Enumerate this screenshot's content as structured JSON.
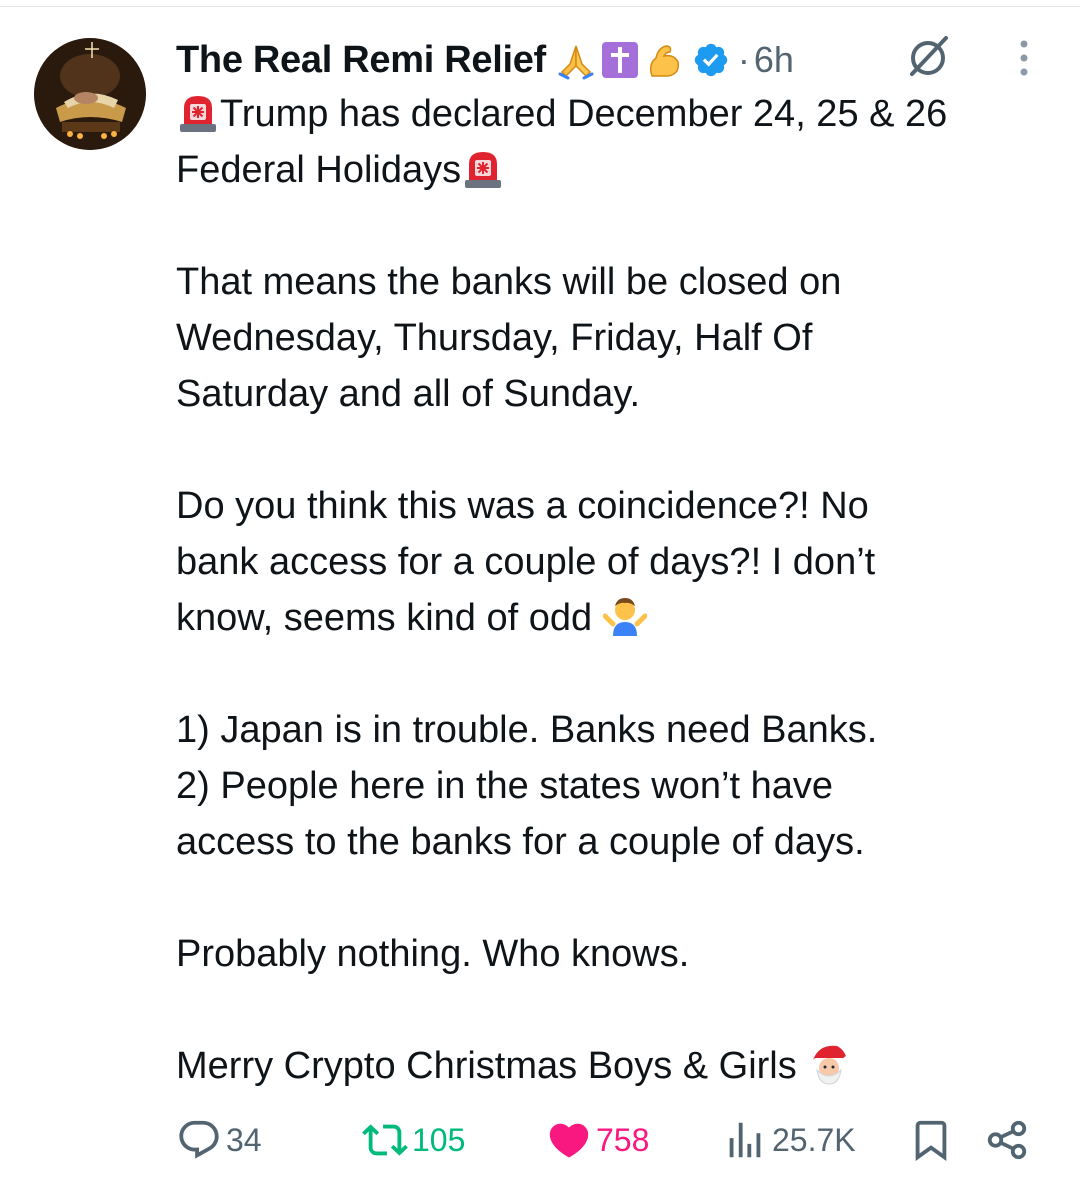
{
  "post": {
    "author": {
      "display_name": "The Real Remi Relief",
      "name_emojis": [
        "folded-hands",
        "latin-cross",
        "flexed-biceps"
      ],
      "verified": true,
      "avatar": "nativity-manger-avatar"
    },
    "time_separator": "·",
    "timestamp": "6h",
    "body": {
      "line1": "Trump has declared December 24, 25 & 26",
      "line2": "Federal Holidays",
      "para2": "That means the banks will be closed on\nWednesday, Thursday, Friday, Half Of\nSaturday and all of Sunday.",
      "para3_text": "Do you think this was a coincidence?! No\nbank access for a couple of days?! I don’t\nknow, seems kind of odd ",
      "para4": "1) Japan is in trouble. Banks need Banks.\n2) People here in the states won’t have\naccess to the banks for a couple of days.",
      "para5": "Probably nothing. Who knows.",
      "para6_text": "Merry Crypto Christmas Boys & Girls "
    },
    "actions": {
      "replies": "34",
      "reposts": "105",
      "likes": "758",
      "views": "25.7K"
    }
  },
  "icons": {
    "grok": "grok-icon",
    "more": "more-vertical-icon",
    "reply": "reply-icon",
    "repost": "repost-icon",
    "like": "heart-icon",
    "views": "views-icon",
    "bookmark": "bookmark-icon",
    "share": "share-icon",
    "siren": "siren-emoji",
    "shrug": "shrug-emoji",
    "santa": "santa-emoji"
  },
  "colors": {
    "text": "#0f1419",
    "muted": "#536471",
    "repost": "#00ba7c",
    "like": "#f91880",
    "verified": "#1d9bf0"
  }
}
